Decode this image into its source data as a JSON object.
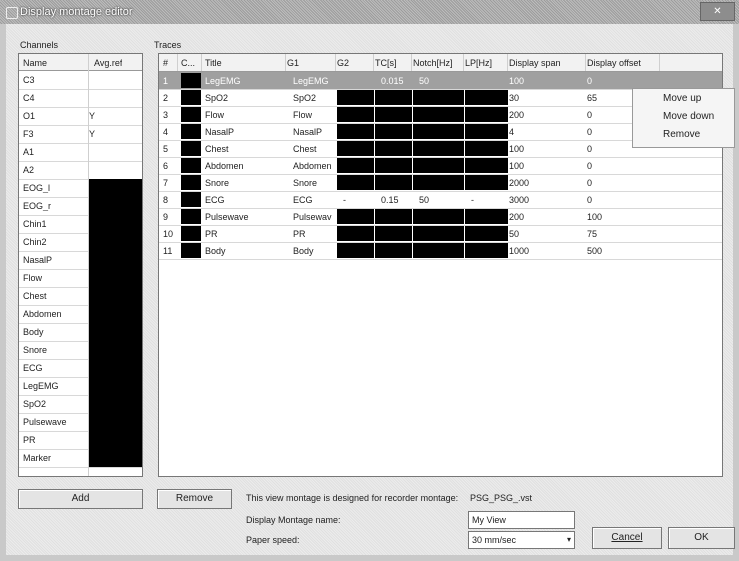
{
  "window": {
    "title": "Display montage editor",
    "close_glyph": "✕"
  },
  "channels": {
    "group_label": "Channels",
    "col_name": "Name",
    "col_avg": "Avg.ref",
    "rows": [
      {
        "name": "C3",
        "avg": "",
        "dark": false
      },
      {
        "name": "C4",
        "avg": "",
        "dark": false
      },
      {
        "name": "O1",
        "avg": "Y",
        "dark": false
      },
      {
        "name": "F3",
        "avg": "Y",
        "dark": false
      },
      {
        "name": "A1",
        "avg": "",
        "dark": false
      },
      {
        "name": "A2",
        "avg": "",
        "dark": false
      },
      {
        "name": "EOG_l",
        "avg": "",
        "dark": true
      },
      {
        "name": "EOG_r",
        "avg": "",
        "dark": true
      },
      {
        "name": "Chin1",
        "avg": "",
        "dark": true
      },
      {
        "name": "Chin2",
        "avg": "",
        "dark": true
      },
      {
        "name": "NasalP",
        "avg": "",
        "dark": true
      },
      {
        "name": "Flow",
        "avg": "",
        "dark": true
      },
      {
        "name": "Chest",
        "avg": "",
        "dark": true
      },
      {
        "name": "Abdomen",
        "avg": "",
        "dark": true
      },
      {
        "name": "Body",
        "avg": "",
        "dark": true
      },
      {
        "name": "Snore",
        "avg": "",
        "dark": true
      },
      {
        "name": "ECG",
        "avg": "",
        "dark": true
      },
      {
        "name": "LegEMG",
        "avg": "",
        "dark": true
      },
      {
        "name": "SpO2",
        "avg": "",
        "dark": true
      },
      {
        "name": "Pulsewave",
        "avg": "",
        "dark": true
      },
      {
        "name": "PR",
        "avg": "",
        "dark": true
      },
      {
        "name": "Marker",
        "avg": "",
        "dark": true
      }
    ],
    "add_button": "Add"
  },
  "traces": {
    "group_label": "Traces",
    "headers": [
      "#",
      "C...",
      "Title",
      "G1",
      "G2",
      "TC[s]",
      "Notch[Hz]",
      "LP[Hz]",
      "Display span",
      "Display offset"
    ],
    "rows": [
      {
        "n": "1",
        "title": "LegEMG",
        "g1": "LegEMG",
        "g2": "",
        "tc": "0.015",
        "notch": "50",
        "lp": "",
        "span": "100",
        "offset": "0",
        "selected": true
      },
      {
        "n": "2",
        "title": "SpO2",
        "g1": "SpO2",
        "g2": "",
        "tc": "",
        "notch": "",
        "lp": "",
        "span": "30",
        "offset": "65",
        "selected": false
      },
      {
        "n": "3",
        "title": "Flow",
        "g1": "Flow",
        "g2": "",
        "tc": "",
        "notch": "",
        "lp": "",
        "span": "200",
        "offset": "0",
        "selected": false
      },
      {
        "n": "4",
        "title": "NasalP",
        "g1": "NasalP",
        "g2": "",
        "tc": "",
        "notch": "",
        "lp": "",
        "span": "4",
        "offset": "0",
        "selected": false
      },
      {
        "n": "5",
        "title": "Chest",
        "g1": "Chest",
        "g2": "",
        "tc": "",
        "notch": "",
        "lp": "",
        "span": "100",
        "offset": "0",
        "selected": false
      },
      {
        "n": "6",
        "title": "Abdomen",
        "g1": "Abdomen",
        "g2": "",
        "tc": "",
        "notch": "",
        "lp": "",
        "span": "100",
        "offset": "0",
        "selected": false
      },
      {
        "n": "7",
        "title": "Snore",
        "g1": "Snore",
        "g2": "",
        "tc": "",
        "notch": "",
        "lp": "",
        "span": "2000",
        "offset": "0",
        "selected": false
      },
      {
        "n": "8",
        "title": "ECG",
        "g1": "ECG",
        "g2": "-",
        "tc": "0.15",
        "notch": "50",
        "lp": "-",
        "span": "3000",
        "offset": "0",
        "selected": false
      },
      {
        "n": "9",
        "title": "Pulsewave",
        "g1": "Pulsewav",
        "g2": "",
        "tc": "",
        "notch": "",
        "lp": "",
        "span": "200",
        "offset": "100",
        "selected": false
      },
      {
        "n": "10",
        "title": "PR",
        "g1": "PR",
        "g2": "",
        "tc": "",
        "notch": "",
        "lp": "",
        "span": "50",
        "offset": "75",
        "selected": false
      },
      {
        "n": "11",
        "title": "Body",
        "g1": "Body",
        "g2": "",
        "tc": "",
        "notch": "",
        "lp": "",
        "span": "1000",
        "offset": "500",
        "selected": false
      }
    ],
    "remove_button": "Remove"
  },
  "context_menu": {
    "items": [
      "Move up",
      "Move down",
      "Remove"
    ]
  },
  "footer": {
    "designed_for_label": "This view montage is designed for recorder montage:",
    "designed_for_value": "PSG_PSG_.vst",
    "montage_name_label": "Display Montage name:",
    "montage_name_value": "My View",
    "paper_speed_label": "Paper speed:",
    "paper_speed_value": "30 mm/sec",
    "cancel_button": "Cancel",
    "ok_button": "OK"
  },
  "colors": {
    "selection": "#a0a0a0",
    "dark_cell": "#000000",
    "title_bar": "#9c9c9c"
  }
}
